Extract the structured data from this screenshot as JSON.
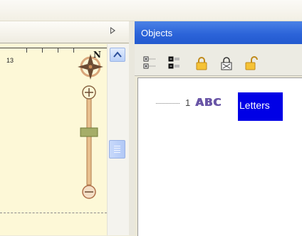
{
  "left_panel": {
    "ruler_label": "13",
    "compass_letter": "N",
    "expand_icon": "triangle-right-icon"
  },
  "objects_panel": {
    "title": "Objects",
    "toolbar": [
      {
        "name": "expand-tree-icon"
      },
      {
        "name": "collapse-tree-icon"
      },
      {
        "name": "lock-icon"
      },
      {
        "name": "lock-selected-icon"
      },
      {
        "name": "unlock-icon"
      }
    ],
    "tree": [
      {
        "index": "1",
        "glyph": "ABC",
        "label": "Letters",
        "selected": true
      }
    ]
  },
  "colors": {
    "header_blue": "#2c64d9",
    "selection_blue": "#0000e6",
    "map_background": "#fdf8d7",
    "zoom_slider": "#c98b57"
  }
}
